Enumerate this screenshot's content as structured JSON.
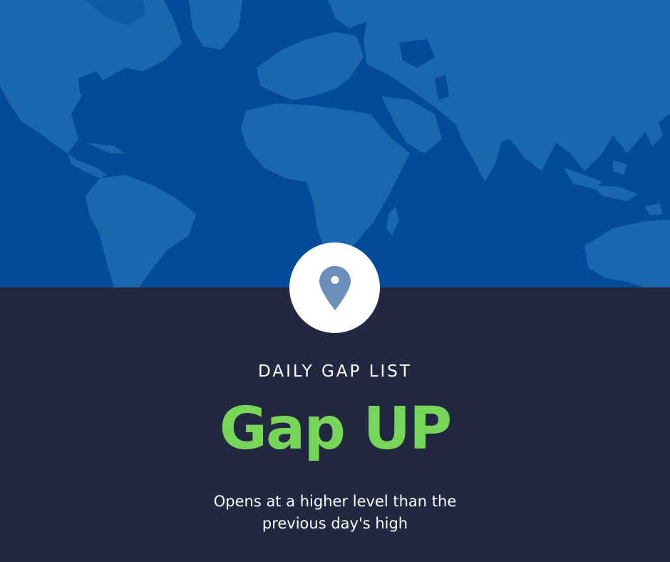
{
  "banner": {
    "eyebrow": "DAILY GAP LIST",
    "headline": "Gap UP",
    "subtitle_line1": "Opens at a higher level than the",
    "subtitle_line2": "previous day's high"
  },
  "icons": {
    "world_map": "world-map-icon",
    "pin": "location-pin-icon"
  },
  "colors": {
    "map_ocean": "#034b98",
    "map_land": "#1a67ad",
    "bottom_background": "#212840",
    "headline": "#77d657",
    "pin": "#6a8fbb",
    "text": "#ffffff"
  }
}
